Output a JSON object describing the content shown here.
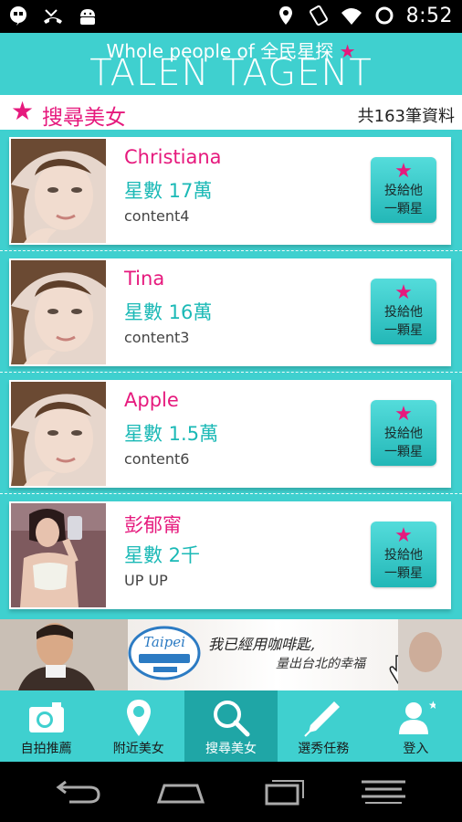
{
  "status_bar": {
    "time": "8:52",
    "left_icons": [
      "hangouts-icon",
      "missed-call-icon",
      "android-icon"
    ],
    "right_icons": [
      "location-icon",
      "vibrate-icon",
      "wifi-icon",
      "sync-icon"
    ]
  },
  "header": {
    "subtitle": "Whole people of 全民星探",
    "title": "TALEN TAGENT"
  },
  "title_row": {
    "label": "搜尋美女",
    "count": "共163筆資料"
  },
  "vote_button": {
    "line1": "投給他",
    "line2": "一顆星"
  },
  "cards": [
    {
      "name": "Christiana",
      "stars": "星數 17萬",
      "content": "content4"
    },
    {
      "name": "Tina",
      "stars": "星數 16萬",
      "content": "content3"
    },
    {
      "name": "Apple",
      "stars": "星數 1.5萬",
      "content": "content6"
    },
    {
      "name": "彭郁甯",
      "stars": "星數 2千",
      "content": "UP UP"
    }
  ],
  "banner": {
    "logo_text": "Taipei",
    "line1": "我已經用咖啡匙,",
    "line2": "量出台北的幸福"
  },
  "tabs": [
    {
      "label": "自拍推薦",
      "icon": "camera-icon",
      "active": false
    },
    {
      "label": "附近美女",
      "icon": "map-pin-icon",
      "active": false
    },
    {
      "label": "搜尋美女",
      "icon": "search-icon",
      "active": true
    },
    {
      "label": "選秀任務",
      "icon": "pen-icon",
      "active": false
    },
    {
      "label": "登入",
      "icon": "user-icon",
      "active": false
    }
  ],
  "colors": {
    "teal": "#3fd0cf",
    "teal_dark": "#1fa6a6",
    "pink": "#e6197d",
    "teal_text": "#1bb9b6"
  }
}
